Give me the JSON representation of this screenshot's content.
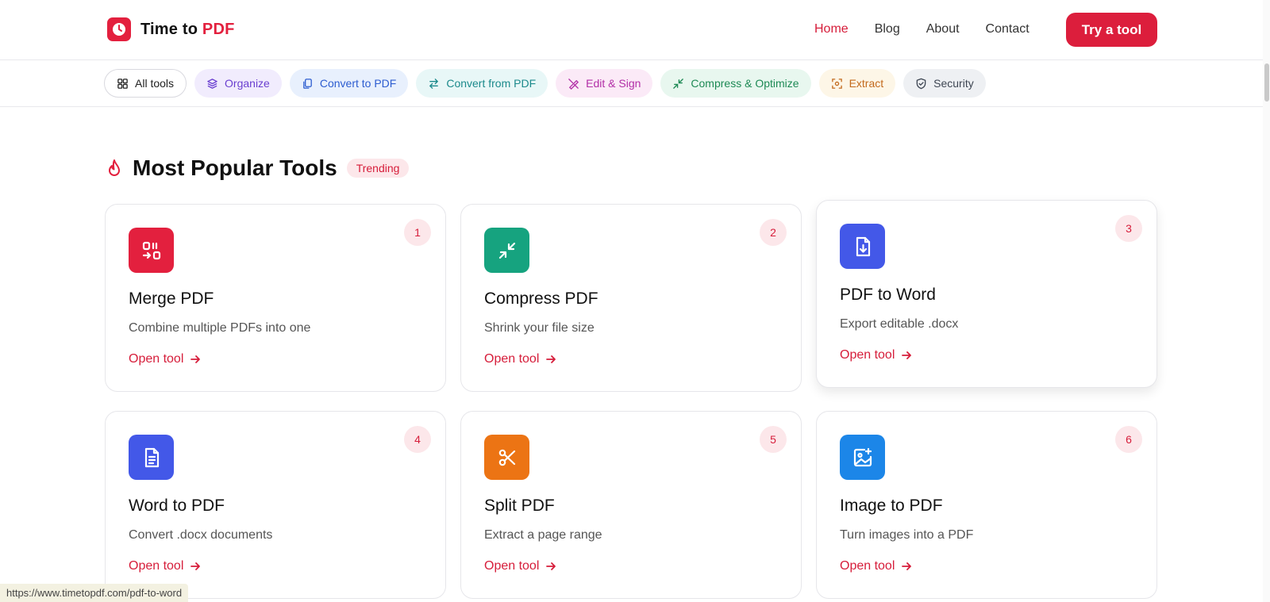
{
  "header": {
    "brand_prefix": "Time to ",
    "brand_accent": "PDF",
    "nav": [
      "Home",
      "Blog",
      "About",
      "Contact"
    ],
    "cta_label": "Try a tool"
  },
  "categories": [
    "All tools",
    "Organize",
    "Convert to PDF",
    "Convert from PDF",
    "Edit & Sign",
    "Compress & Optimize",
    "Extract",
    "Security"
  ],
  "section": {
    "title": "Most Popular Tools",
    "badge": "Trending"
  },
  "tools": [
    {
      "rank": "1",
      "name": "Merge PDF",
      "desc": "Combine multiple PDFs into one",
      "link": "Open tool",
      "icon": "merge-icon",
      "color": "#e3203e"
    },
    {
      "rank": "2",
      "name": "Compress PDF",
      "desc": "Shrink your file size",
      "link": "Open tool",
      "icon": "compress-icon",
      "color": "#16a37f"
    },
    {
      "rank": "3",
      "name": "PDF to Word",
      "desc": "Export editable .docx",
      "link": "Open tool",
      "icon": "file-download-icon",
      "color": "#4358e8"
    },
    {
      "rank": "4",
      "name": "Word to PDF",
      "desc": "Convert .docx documents",
      "link": "Open tool",
      "icon": "document-icon",
      "color": "#4358e8"
    },
    {
      "rank": "5",
      "name": "Split PDF",
      "desc": "Extract a page range",
      "link": "Open tool",
      "icon": "scissors-icon",
      "color": "#ec7414"
    },
    {
      "rank": "6",
      "name": "Image to PDF",
      "desc": "Turn images into a PDF",
      "link": "Open tool",
      "icon": "image-plus-icon",
      "color": "#1c86e8"
    }
  ],
  "status_url": "https://www.timetopdf.com/pdf-to-word"
}
